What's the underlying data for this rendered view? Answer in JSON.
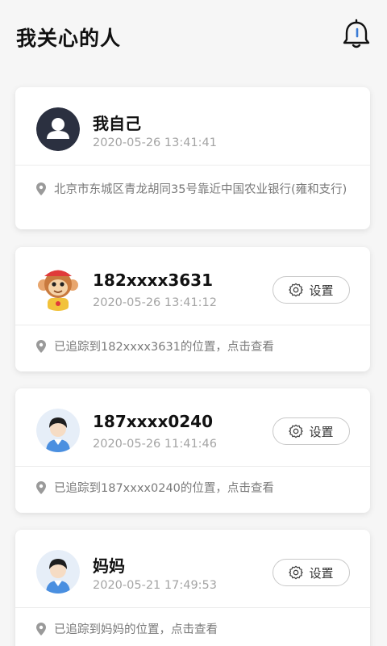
{
  "header": {
    "title": "我关心的人"
  },
  "icons": {
    "bell": "bell-icon",
    "settings": "gear-icon",
    "location": "map-pin-icon"
  },
  "colors": {
    "title": "#111111",
    "time": "#a4a4a4",
    "loc": "#7a7a7a",
    "bell_accent": "#3a7bd5"
  },
  "cards": [
    {
      "name": "我自己",
      "time": "2020-05-26 13:41:41",
      "location": "北京市东城区青龙胡同35号靠近中国农业银行(雍和支行)",
      "avatar": "user-silhouette-avatar"
    },
    {
      "name": "182xxxx3631",
      "time": "2020-05-26 13:41:12",
      "location": "已追踪到182xxxx3631的位置，点击查看",
      "settings_label": "设置",
      "avatar": "monkey-avatar"
    },
    {
      "name": "187xxxx0240",
      "time": "2020-05-26 11:41:46",
      "location": "已追踪到187xxxx0240的位置，点击查看",
      "settings_label": "设置",
      "avatar": "person-avatar"
    },
    {
      "name": "妈妈",
      "time": "2020-05-21 17:49:53",
      "location": "已追踪到妈妈的位置，点击查看",
      "settings_label": "设置",
      "avatar": "person-avatar"
    }
  ]
}
